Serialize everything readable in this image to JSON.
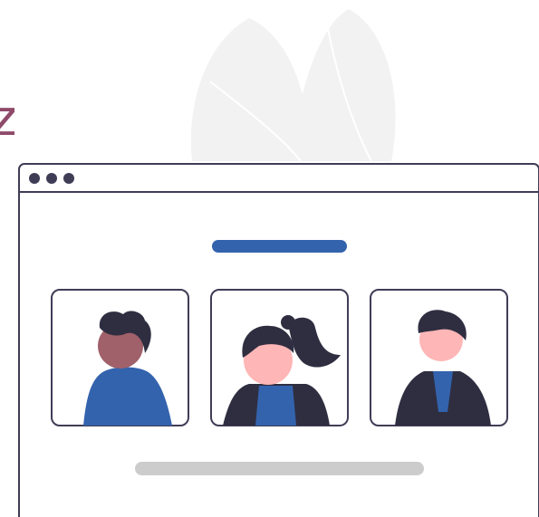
{
  "corner_text": "z",
  "colors": {
    "outline": "#3f3d56",
    "accent_bar": "#3363ad",
    "placeholder_bar": "#cccccc",
    "leaf": "#f2f2f2",
    "leaf_vein": "#ffffff",
    "skin_light": "#ffb6b6",
    "skin_dark": "#a0616a",
    "hair": "#2f2e41",
    "shirt_blue": "#3363ad",
    "jacket_dark": "#2f2e41",
    "corner_text": "#8f4a6a"
  },
  "window": {
    "dots": [
      "window-dot",
      "window-dot",
      "window-dot"
    ]
  },
  "people": [
    {
      "icon": "person-back-icon"
    },
    {
      "icon": "person-ponytail-icon"
    },
    {
      "icon": "person-jacket-icon"
    }
  ]
}
